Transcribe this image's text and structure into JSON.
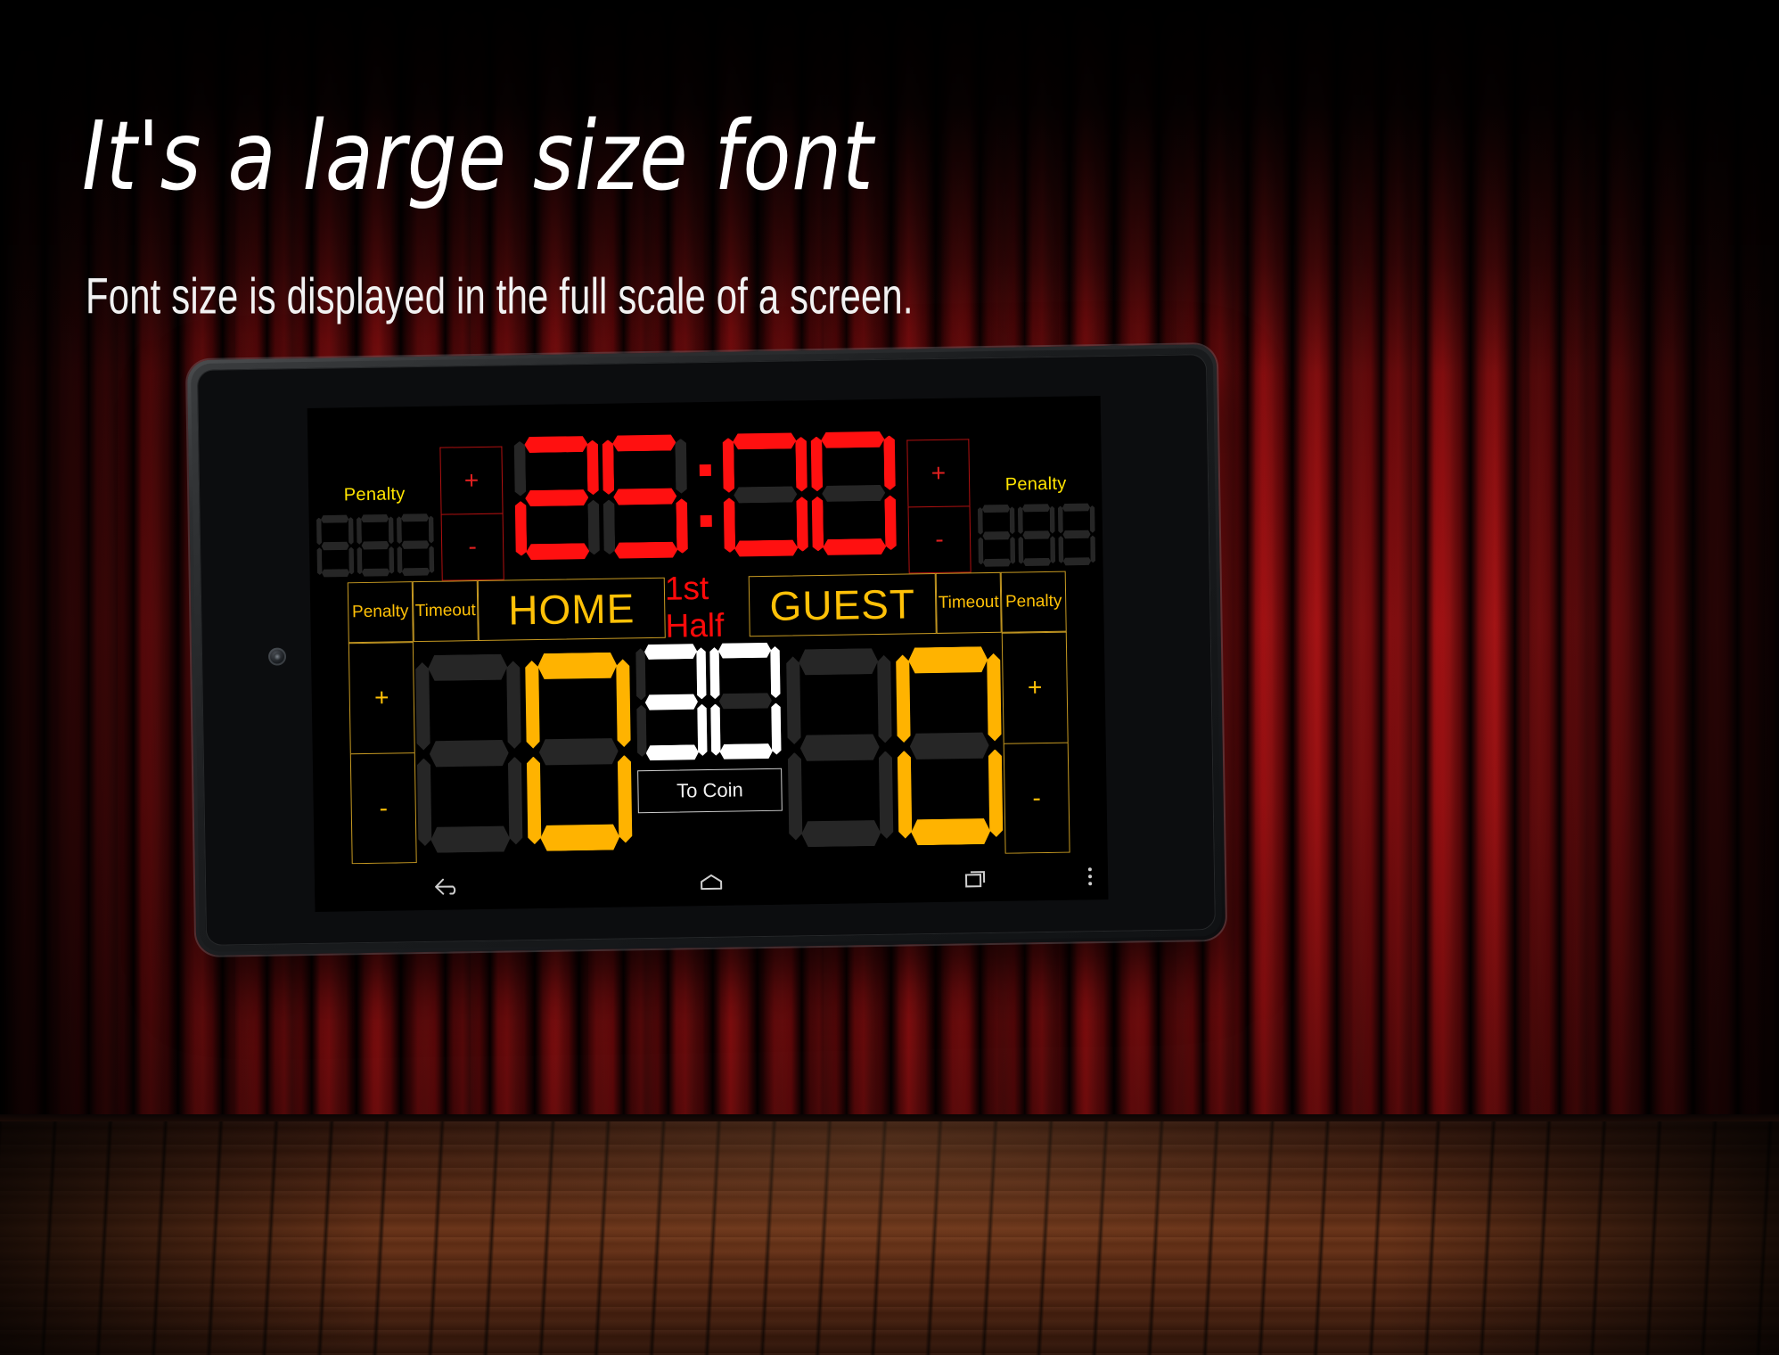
{
  "promo": {
    "headline": "It's a large size font",
    "subline": "Font size is displayed in the full scale of a screen."
  },
  "colors": {
    "clock_red": "#ff1010",
    "score_amber": "#ffb300",
    "shotclock_white": "#ffffff",
    "segment_off": "#262626",
    "label_gold": "#ffc107",
    "penalty_label_yellow": "#ffe400",
    "half_red": "#ff0a0a",
    "grid_gold": "#c79a22",
    "grid_red": "#b01010"
  },
  "app": {
    "clock": {
      "minutes": "25",
      "separator": ":",
      "seconds": "00",
      "plus_label": "+",
      "minus_label": "-"
    },
    "penalty_left": {
      "label": "Penalty",
      "digits": "000",
      "active": false
    },
    "penalty_right": {
      "label": "Penalty",
      "digits": "000",
      "active": false
    },
    "header_row": {
      "home_penalty_label": "Penalty",
      "home_timeout_label": "Timeout",
      "home_team": "HOME",
      "period": "1st Half",
      "guest_team": "GUEST",
      "guest_timeout_label": "Timeout",
      "guest_penalty_label": "Penalty"
    },
    "score": {
      "home": "0",
      "guest": "0",
      "home_plus_label": "+",
      "home_minus_label": "-",
      "guest_plus_label": "+",
      "guest_minus_label": "-"
    },
    "shot_clock": {
      "value": "30"
    },
    "to_coin_button": "To Coin"
  },
  "navbar": {
    "back": "back-icon",
    "home": "home-icon",
    "recents": "recents-icon",
    "overflow": "overflow-menu-icon"
  }
}
